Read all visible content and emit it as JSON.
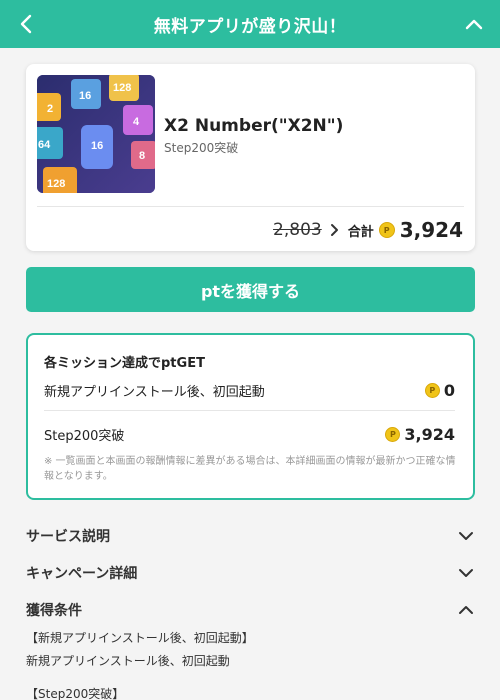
{
  "header": {
    "title": "無料アプリが盛り沢山！"
  },
  "app": {
    "name": "X2 Number(\"X2N\")",
    "subtitle": "Step200突破",
    "icon_tiles": [
      "2",
      "16",
      "128",
      "64",
      "16",
      "4",
      "8",
      "128"
    ],
    "old_price": "2,803",
    "total_label": "合計",
    "total_value": "3,924",
    "coin_glyph": "P"
  },
  "cta": {
    "label": "ptを獲得する"
  },
  "missions": {
    "title": "各ミッション達成でptGET",
    "items": [
      {
        "label": "新規アプリインストール後、初回起動",
        "value": "0"
      },
      {
        "label": "Step200突破",
        "value": "3,924"
      }
    ],
    "note": "※ 一覧画面と本画面の報酬情報に差異がある場合は、本詳細画面の情報が最新かつ正確な情報となります。"
  },
  "sections": [
    {
      "label": "サービス説明",
      "state": "collapsed"
    },
    {
      "label": "キャンペーン詳細",
      "state": "collapsed"
    },
    {
      "label": "獲得条件",
      "state": "expanded"
    }
  ],
  "conditions": {
    "heading1": "【新規アプリインストール後、初回起動】",
    "text1": "新規アプリインストール後、初回起動",
    "heading2": "【Step200突破】"
  },
  "colors": {
    "accent": "#2dbd9f",
    "coin": "#f0c419",
    "background": "#f4f4f4"
  }
}
